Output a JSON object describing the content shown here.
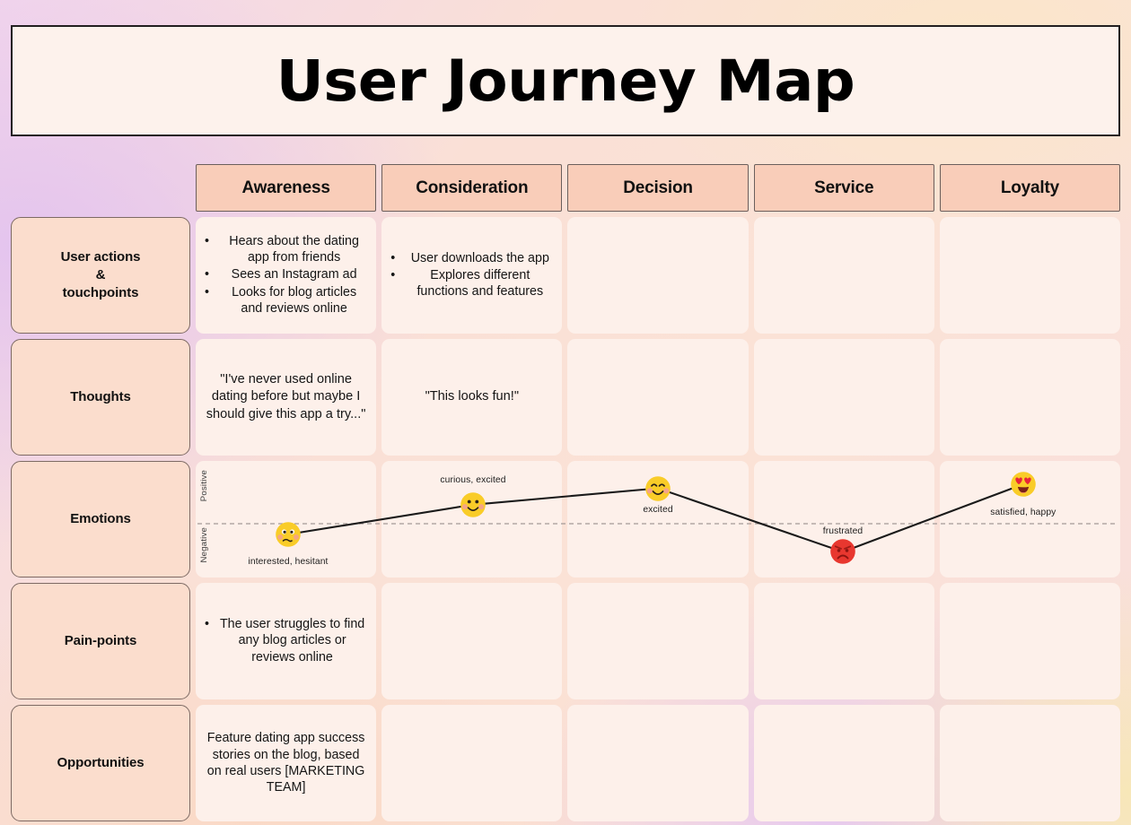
{
  "title": "User Journey Map",
  "phases": [
    {
      "label": "Awareness"
    },
    {
      "label": "Consideration"
    },
    {
      "label": "Decision"
    },
    {
      "label": "Service"
    },
    {
      "label": "Loyalty"
    }
  ],
  "rows": [
    {
      "label": "User actions\n&\ntouchpoints",
      "label_lines": [
        "User actions",
        "&",
        "touchpoints"
      ],
      "cells": [
        {
          "type": "bullets",
          "items": [
            "Hears about the dating app from friends",
            "Sees an Instagram ad",
            "Looks for blog articles and reviews online"
          ]
        },
        {
          "type": "bullets",
          "items": [
            "User downloads the app",
            "Explores different functions and features"
          ]
        },
        {
          "type": "empty",
          "text": ""
        },
        {
          "type": "empty",
          "text": ""
        },
        {
          "type": "empty",
          "text": ""
        }
      ]
    },
    {
      "label": "Thoughts",
      "label_lines": [
        "Thoughts"
      ],
      "cells": [
        {
          "type": "text",
          "text": "\"I've never used online dating before but maybe I should give this app a try...\""
        },
        {
          "type": "text",
          "text": "\"This looks fun!\""
        },
        {
          "type": "empty",
          "text": ""
        },
        {
          "type": "empty",
          "text": ""
        },
        {
          "type": "empty",
          "text": ""
        }
      ]
    },
    {
      "label": "Emotions",
      "label_lines": [
        "Emotions"
      ],
      "cells": [
        {
          "type": "empty",
          "text": ""
        },
        {
          "type": "empty",
          "text": ""
        },
        {
          "type": "empty",
          "text": ""
        },
        {
          "type": "empty",
          "text": ""
        },
        {
          "type": "empty",
          "text": ""
        }
      ]
    },
    {
      "label": "Pain-points",
      "label_lines": [
        "Pain-points"
      ],
      "cells": [
        {
          "type": "bullets",
          "items": [
            "The user struggles to find any blog articles or reviews online"
          ]
        },
        {
          "type": "empty",
          "text": ""
        },
        {
          "type": "empty",
          "text": ""
        },
        {
          "type": "empty",
          "text": ""
        },
        {
          "type": "empty",
          "text": ""
        }
      ]
    },
    {
      "label": "Opportunities",
      "label_lines": [
        "Opportunities"
      ],
      "cells": [
        {
          "type": "text",
          "text": "Feature dating app success stories on the blog, based on real users [MARKETING TEAM]"
        },
        {
          "type": "empty",
          "text": ""
        },
        {
          "type": "empty",
          "text": ""
        },
        {
          "type": "empty",
          "text": ""
        },
        {
          "type": "empty",
          "text": ""
        }
      ]
    }
  ],
  "emotions": {
    "axis": {
      "positive": "Positive",
      "negative": "Negative"
    },
    "baseline_label": "neutral-divider",
    "points": [
      {
        "phase": "Awareness",
        "label": "interested, hesitant",
        "face": "confused-face",
        "color": "#f9cc28",
        "x_pct": 10.0,
        "y_pct": 63.0,
        "label_y_pct": 82.0
      },
      {
        "phase": "Consideration",
        "label": "curious, excited",
        "face": "smiling-face",
        "color": "#f9cc28",
        "x_pct": 30.0,
        "y_pct": 37.5,
        "label_y_pct": 12.0
      },
      {
        "phase": "Decision",
        "label": "excited",
        "face": "blushing-face",
        "color": "#f9cc28",
        "x_pct": 50.0,
        "y_pct": 23.5,
        "label_y_pct": 38.0
      },
      {
        "phase": "Service",
        "label": "frustrated",
        "face": "angry-face",
        "color": "#e8372f",
        "x_pct": 70.0,
        "y_pct": 78.0,
        "label_y_pct": 56.0
      },
      {
        "phase": "Loyalty",
        "label": "satisfied, happy",
        "face": "heart-eyes-face",
        "color": "#f9cc28",
        "x_pct": 89.5,
        "y_pct": 20.0,
        "label_y_pct": 40.0
      }
    ]
  },
  "colors": {
    "title_panel": "#fdf2ec",
    "phase_header": "#f9cdb9",
    "row_label": "#fbddcd",
    "cell": "#fdf0ea",
    "line": "#1a1a1a",
    "text": "#151515"
  }
}
